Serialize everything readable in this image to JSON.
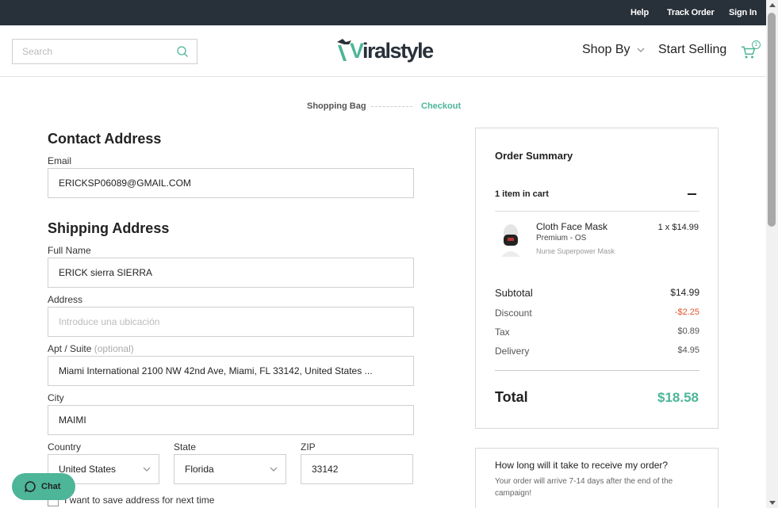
{
  "topbar": {
    "help": "Help",
    "track_order": "Track Order",
    "sign_in": "Sign In"
  },
  "header": {
    "search_placeholder": "Search",
    "logo_v": "V",
    "logo_rest": "iralstyle",
    "shop_by": "Shop By",
    "start_selling": "Start Selling",
    "cart_count": "1"
  },
  "steps": {
    "bag": "Shopping Bag",
    "checkout": "Checkout"
  },
  "contact": {
    "title": "Contact Address",
    "email_label": "Email",
    "email_value": "ERICKSP06089@GMAIL.COM"
  },
  "shipping": {
    "title": "Shipping Address",
    "fullname_label": "Full Name",
    "fullname_value": "ERICK sierra SIERRA",
    "address_label": "Address",
    "address_placeholder": "Introduce una ubicación",
    "apt_label": "Apt / Suite",
    "apt_optional": "(optional)",
    "apt_value": "Miami International 2100 NW 42nd Ave, Miami, FL 33142, United States ...",
    "city_label": "City",
    "city_value": "MAIMI",
    "country_label": "Country",
    "country_value": "United States",
    "state_label": "State",
    "state_value": "Florida",
    "zip_label": "ZIP",
    "zip_value": "33142",
    "save_label": "I want to save address for next time"
  },
  "summary": {
    "title": "Order Summary",
    "item_count": "1 item in cart",
    "product": {
      "name": "Cloth Face Mask",
      "variant": "Premium - OS",
      "campaign": "Nurse Superpower Mask",
      "qty_price": "1 x $14.99"
    },
    "subtotal_label": "Subtotal",
    "subtotal": "$14.99",
    "discount_label": "Discount",
    "discount": "-$2.25",
    "tax_label": "Tax",
    "tax": "$0.89",
    "delivery_label": "Delivery",
    "delivery": "$4.95",
    "total_label": "Total",
    "total": "$18.58"
  },
  "faq": {
    "question": "How long will it take to receive my order?",
    "answer": "Your order will arrive 7-14 days after the end of the campaign!"
  },
  "chat": {
    "label": "Chat"
  },
  "colors": {
    "accent": "#4db598",
    "topbar": "#283039",
    "discount": "#e0552f"
  }
}
